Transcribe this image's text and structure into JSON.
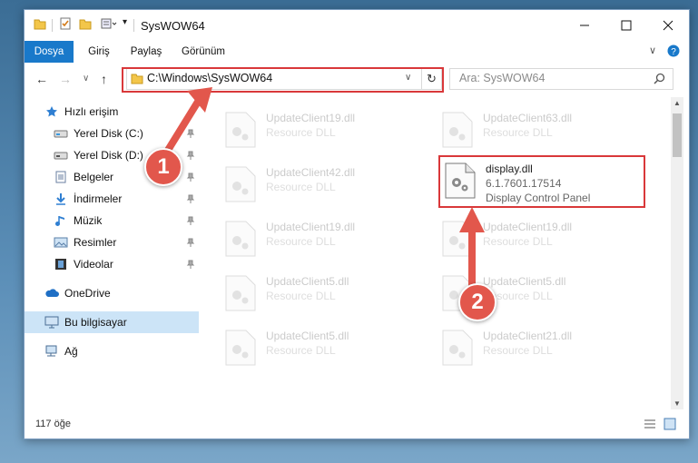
{
  "window": {
    "title": "SysWOW64"
  },
  "ribbon": {
    "tabs": [
      "Dosya",
      "Giriş",
      "Paylaş",
      "Görünüm"
    ]
  },
  "address": {
    "path": "C:\\Windows\\SysWOW64",
    "search_placeholder": "Ara: SysWOW64"
  },
  "nav": {
    "quick_access": "Hızlı erişim",
    "items": [
      "Yerel Disk (C:)",
      "Yerel Disk (D:)",
      "Belgeler",
      "İndirmeler",
      "Müzik",
      "Resimler",
      "Videolar"
    ],
    "onedrive": "OneDrive",
    "this_pc": "Bu bilgisayar",
    "network": "Ağ"
  },
  "files": [
    {
      "name": "UpdateClient19.dll",
      "desc": "Resource DLL"
    },
    {
      "name": "UpdateClient63.dll",
      "desc": "Resource DLL"
    },
    {
      "name": "UpdateClient42.dll",
      "desc": "Resource DLL"
    },
    {
      "name": "display.dll",
      "version": "6.1.7601.17514",
      "desc": "Display Control Panel"
    },
    {
      "name": "UpdateClient19.dll",
      "desc": "Resource DLL"
    },
    {
      "name": "UpdateClient19.dll",
      "desc": "Resource DLL"
    },
    {
      "name": "UpdateClient5.dll",
      "desc": "Resource DLL"
    },
    {
      "name": "UpdateClient5.dll",
      "desc": "Resource DLL"
    },
    {
      "name": "UpdateClient5.dll",
      "desc": "Resource DLL"
    },
    {
      "name": "UpdateClient21.dll",
      "desc": "Resource DLL"
    }
  ],
  "status": {
    "count": "117 öğe"
  },
  "annotations": {
    "step1": "1",
    "step2": "2"
  },
  "colors": {
    "accent": "#1979ca",
    "annotation": "#d9383a"
  }
}
